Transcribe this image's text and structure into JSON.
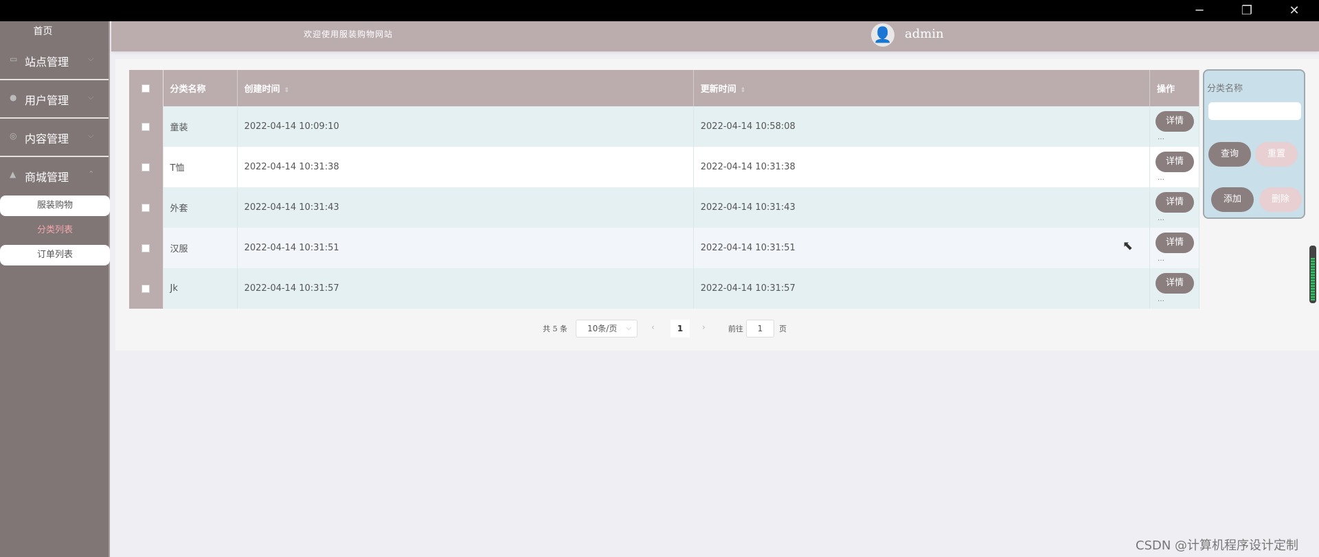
{
  "window": {
    "minimize": "─",
    "maximize": "❐",
    "close": "✕"
  },
  "sidebar": {
    "home": "首页",
    "groups": [
      {
        "label": "站点管理",
        "icon": "monitor-icon"
      },
      {
        "label": "用户管理",
        "icon": "user-icon"
      },
      {
        "label": "内容管理",
        "icon": "content-icon"
      },
      {
        "label": "商城管理",
        "icon": "shop-icon"
      }
    ],
    "sub_items": [
      "服装购物",
      "分类列表",
      "订单列表"
    ],
    "active_sub": "分类列表",
    "arrow_down": "⌵",
    "arrow_up": "⌃"
  },
  "header": {
    "welcome": "欢迎使用服装购物网站",
    "username": "admin",
    "avatar_glyph": "👤"
  },
  "table": {
    "columns": [
      "分类名称",
      "创建时间",
      "更新时间",
      "操作"
    ],
    "sort_glyph": "⇕",
    "rows": [
      {
        "name": "童装",
        "created": "2022-04-14 10:09:10",
        "updated": "2022-04-14 10:58:08"
      },
      {
        "name": "T恤",
        "created": "2022-04-14 10:31:38",
        "updated": "2022-04-14 10:31:38"
      },
      {
        "name": "外套",
        "created": "2022-04-14 10:31:43",
        "updated": "2022-04-14 10:31:43"
      },
      {
        "name": "汉服",
        "created": "2022-04-14 10:31:51",
        "updated": "2022-04-14 10:31:51"
      },
      {
        "name": "Jk",
        "created": "2022-04-14 10:31:57",
        "updated": "2022-04-14 10:31:57"
      }
    ],
    "detail_label": "详情",
    "ellipsis": "…"
  },
  "search": {
    "label": "分类名称",
    "query_btn": "查询",
    "reset_btn": "重置",
    "add_btn": "添加",
    "delete_btn": "删除"
  },
  "pager": {
    "total": "共 5 条",
    "page_size": "10条/页",
    "caret": "⌵",
    "prev": "‹",
    "current": "1",
    "next": "›",
    "goto_label": "前往",
    "goto_value": "1",
    "page_unit": "页"
  },
  "cursor": "⬉",
  "watermark": "CSDN @计算机程序设计定制"
}
